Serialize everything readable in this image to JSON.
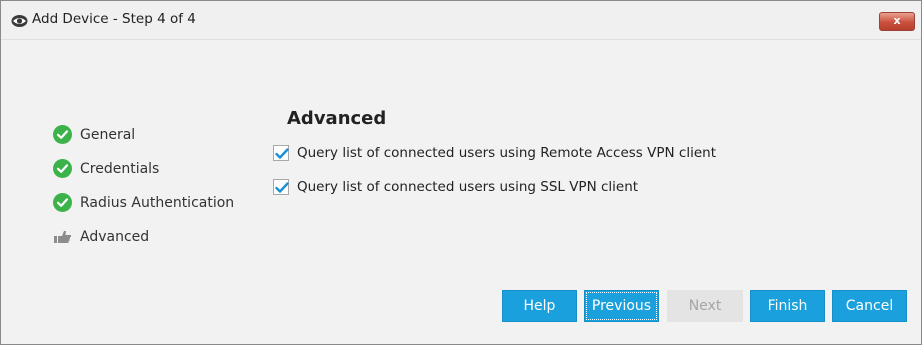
{
  "window": {
    "title": "Add Device - Step 4 of 4",
    "app_icon": "eye-icon",
    "close_icon": "close-icon",
    "close_label": "x"
  },
  "steps": [
    {
      "label": "General",
      "status": "completed",
      "icon": "check-circle-icon"
    },
    {
      "label": "Credentials",
      "status": "completed",
      "icon": "check-circle-icon"
    },
    {
      "label": "Radius Authentication",
      "status": "completed",
      "icon": "check-circle-icon"
    },
    {
      "label": "Advanced",
      "status": "current",
      "icon": "pointing-hand-icon"
    }
  ],
  "main": {
    "section_title": "Advanced",
    "options": [
      {
        "label": "Query list of connected users using Remote Access VPN client",
        "checked": true
      },
      {
        "label": "Query list of connected users using SSL VPN client",
        "checked": true
      }
    ]
  },
  "buttons": {
    "help": "Help",
    "previous": "Previous",
    "next": "Next",
    "finish": "Finish",
    "cancel": "Cancel",
    "next_disabled": true
  },
  "colors": {
    "accent": "#1aa0dc",
    "check_green": "#3cb34a",
    "close_red": "#c9503c",
    "disabled_gray": "#e4e4e4"
  }
}
